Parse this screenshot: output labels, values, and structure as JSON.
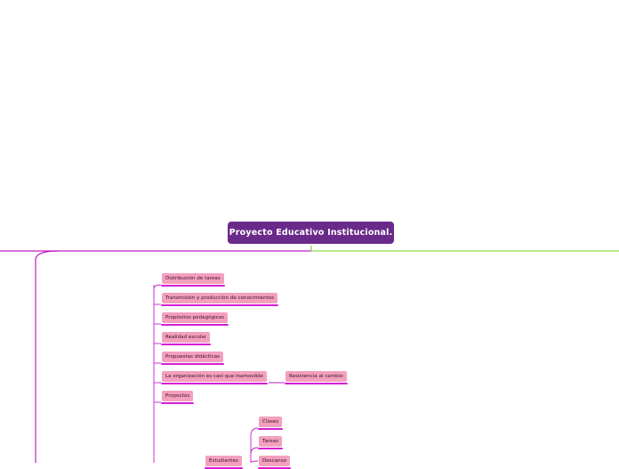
{
  "root": {
    "title": "Proyecto Educativo Institucional."
  },
  "branch_main": {
    "items": [
      "Distribución de tareas",
      "Transmisión y producción de conocimientos",
      "Propósitos pedagógicos",
      "Realidad escolar",
      "Propuestas didácticas",
      "La organización es casi que inamovible",
      "Proyectos"
    ],
    "sub_organizacion": "Resistencia al cambio"
  },
  "branch_estudiantes": {
    "label": "Estudiantes",
    "items": [
      "Clases",
      "Tareas",
      "Descanso"
    ]
  },
  "colors": {
    "root": "#6a2a8a",
    "node": "#f3a0bd",
    "left_branch": "#c21fc6",
    "right_branch": "#8fe04a"
  }
}
